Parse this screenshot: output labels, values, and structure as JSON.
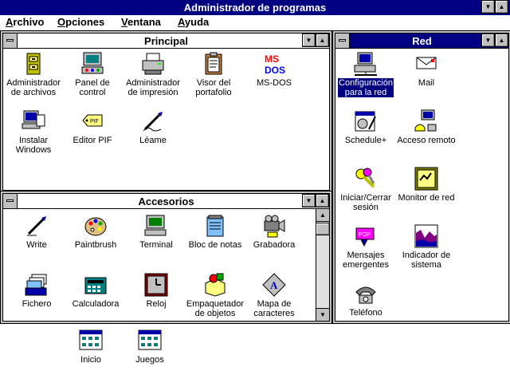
{
  "app": {
    "title": "Administrador de programas"
  },
  "menu": [
    {
      "label": "Archivo"
    },
    {
      "label": "Opciones"
    },
    {
      "label": "Ventana"
    },
    {
      "label": "Ayuda"
    }
  ],
  "principal": {
    "title": "Principal",
    "items": [
      {
        "label": "Administrador\nde archivos",
        "icon": "file-cabinet-icon"
      },
      {
        "label": "Panel de\ncontrol",
        "icon": "control-panel-icon"
      },
      {
        "label": "Administrador\nde impresión",
        "icon": "printer-icon"
      },
      {
        "label": "Visor del\nportafolio",
        "icon": "clipboard-viewer-icon"
      },
      {
        "label": "MS-DOS",
        "icon": "ms-dos-icon"
      },
      {
        "label": "Instalar\nWindows",
        "icon": "setup-computer-icon"
      },
      {
        "label": "Editor PIF",
        "icon": "pif-tag-icon"
      },
      {
        "label": "Léame",
        "icon": "pen-readme-icon"
      }
    ]
  },
  "accesorios": {
    "title": "Accesorios",
    "items": [
      {
        "label": "Write",
        "icon": "pen-write-icon"
      },
      {
        "label": "Paintbrush",
        "icon": "palette-icon"
      },
      {
        "label": "Terminal",
        "icon": "terminal-computer-icon"
      },
      {
        "label": "Bloc de notas",
        "icon": "notepad-icon"
      },
      {
        "label": "Grabadora",
        "icon": "recorder-camera-icon"
      },
      {
        "label": "Fichero",
        "icon": "cardfile-icon"
      },
      {
        "label": "Calculadora",
        "icon": "calculator-icon"
      },
      {
        "label": "Reloj",
        "icon": "clock-icon"
      },
      {
        "label": "Empaquetador\nde objetos",
        "icon": "packager-icon"
      },
      {
        "label": "Mapa de\ncaracteres",
        "icon": "character-map-icon"
      }
    ]
  },
  "red": {
    "title": "Red",
    "items": [
      {
        "label": "Configuración\npara la red",
        "icon": "network-setup-icon",
        "selected": true
      },
      {
        "label": "Mail",
        "icon": "mail-icon"
      },
      {
        "label": "Schedule+",
        "icon": "schedule-icon"
      },
      {
        "label": "Acceso remoto",
        "icon": "remote-access-icon"
      },
      {
        "label": "Iniciar/Cerrar\nsesión",
        "icon": "keys-icon"
      },
      {
        "label": "Monitor de red",
        "icon": "net-monitor-icon"
      },
      {
        "label": "Mensajes\nemergentes",
        "icon": "popup-messages-icon"
      },
      {
        "label": "Indicador de\nsistema",
        "icon": "system-meter-icon"
      },
      {
        "label": "Teléfono",
        "icon": "telephone-icon"
      }
    ]
  },
  "minimized": [
    {
      "label": "Inicio",
      "icon": "program-group-icon"
    },
    {
      "label": "Juegos",
      "icon": "program-group-icon"
    }
  ],
  "colors": {
    "titlebar": "#000080",
    "window_frame": "#c0c0c0",
    "selection": "#000080"
  }
}
